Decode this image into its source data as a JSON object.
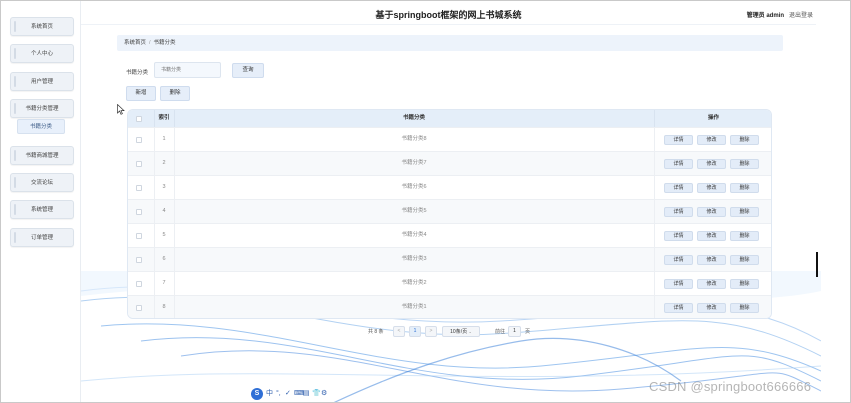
{
  "app": {
    "title": "基于springboot框架的网上书城系统",
    "role_label": "管理员",
    "username": "admin",
    "logout_label": "退出登录"
  },
  "sidebar": {
    "items": [
      {
        "label": "系统首页"
      },
      {
        "label": "个人中心"
      },
      {
        "label": "用户管理"
      },
      {
        "label": "书籍分类管理"
      },
      {
        "label": "书籍商城管理"
      },
      {
        "label": "交流论坛"
      },
      {
        "label": "系统管理"
      },
      {
        "label": "订单管理"
      }
    ],
    "sub_item": {
      "label": "书籍分类"
    }
  },
  "breadcrumb": {
    "home": "系统首页",
    "separator": "/",
    "current": "书籍分类"
  },
  "search": {
    "label": "书籍分类",
    "placeholder": "书籍分类",
    "button": "查询"
  },
  "actions": {
    "add": "新增",
    "delete": "删除"
  },
  "table": {
    "headers": {
      "index": "索引",
      "category": "书籍分类",
      "operation": "操作"
    },
    "row_buttons": {
      "detail": "详情",
      "edit": "修改",
      "delete": "删除"
    },
    "rows": [
      {
        "index": "1",
        "category": "书籍分类8"
      },
      {
        "index": "2",
        "category": "书籍分类7"
      },
      {
        "index": "3",
        "category": "书籍分类6"
      },
      {
        "index": "4",
        "category": "书籍分类5"
      },
      {
        "index": "5",
        "category": "书籍分类4"
      },
      {
        "index": "6",
        "category": "书籍分类3"
      },
      {
        "index": "7",
        "category": "书籍分类2"
      },
      {
        "index": "8",
        "category": "书籍分类1"
      }
    ]
  },
  "pagination": {
    "total": "共 8 条",
    "prev": "<",
    "current_page": "1",
    "next": ">",
    "page_size": "10条/页",
    "goto_label": "前往",
    "goto_value": "1",
    "page_suffix": "页"
  },
  "toolbar": {
    "logo": "S",
    "items": [
      "中",
      "°,",
      "✓",
      "⌨",
      "▤",
      "👕",
      "⚙"
    ]
  },
  "watermark": "CSDN @springboot666666",
  "colors": {
    "accent": "#2f6fd6",
    "table_header": "#e4eef9",
    "button": "#e6eef9",
    "wave": "#4a90e2"
  }
}
